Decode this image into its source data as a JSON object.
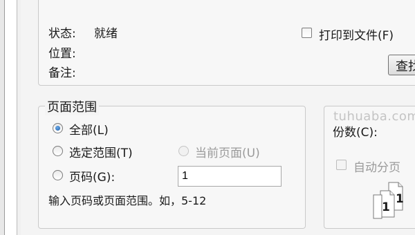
{
  "printer": {
    "status_label": "状态:",
    "status_value": "就绪",
    "location_label": "位置:",
    "comment_label": "备注:",
    "print_to_file_label": "打印到文件(F)",
    "find_button_label": "查找"
  },
  "page_range": {
    "title": "页面范围",
    "all_label": "全部(L)",
    "selection_label": "选定范围(T)",
    "current_page_label": "当前页面(U)",
    "pages_label": "页码(G):",
    "pages_value": "1",
    "hint": "输入页码或页面范围。如，5-12"
  },
  "copies": {
    "label": "份数(C):",
    "collate_label": "自动分页",
    "collate_icon_page_a": "1",
    "collate_icon_page_b": "1"
  },
  "watermark": "tuhuaba.com",
  "colors": {
    "radio_fill": "#1f5ea8",
    "group_border": "#c9c9c9",
    "disabled_text": "#9a9a9a"
  }
}
